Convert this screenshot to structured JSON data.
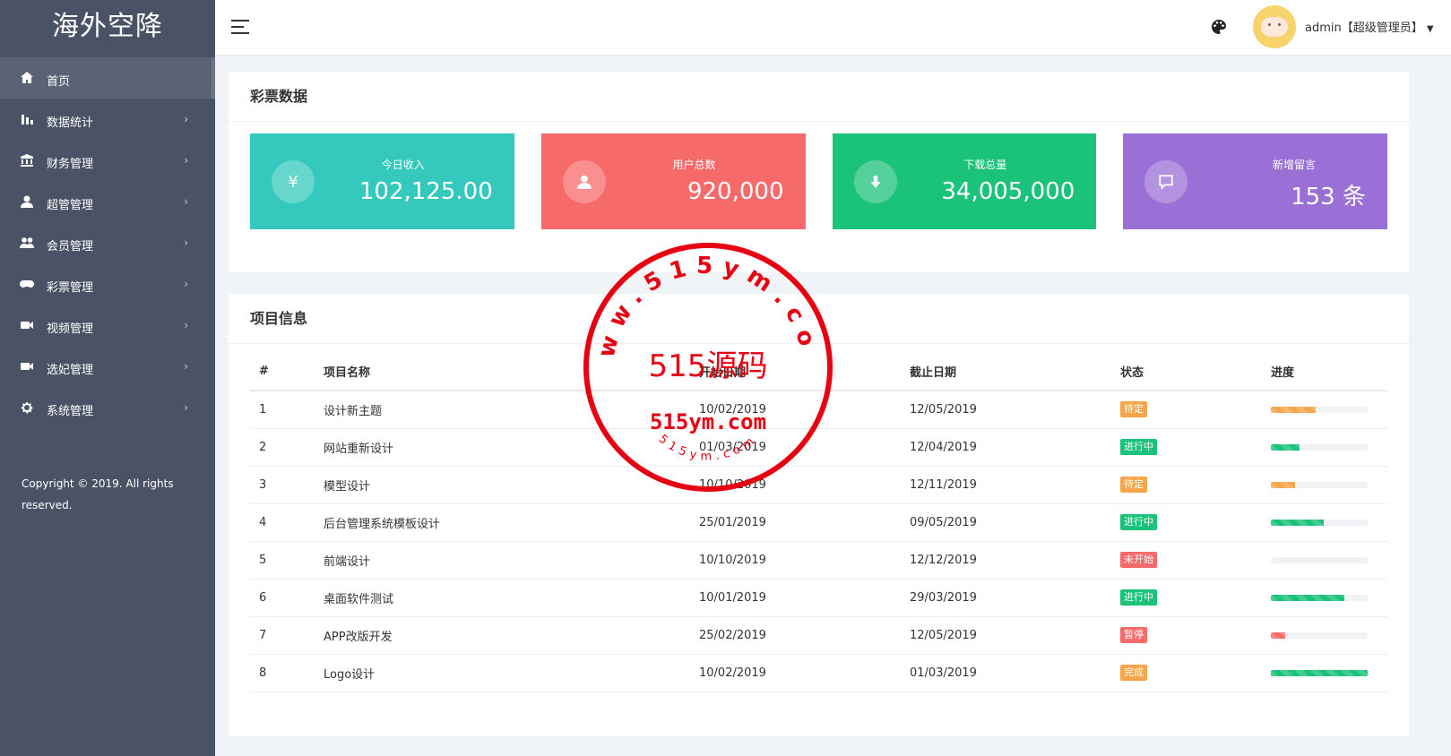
{
  "sidebar": {
    "brand": "海外空降",
    "items": [
      {
        "label": "首页",
        "icon": "home-icon"
      },
      {
        "label": "数据统计",
        "icon": "bar-chart-icon"
      },
      {
        "label": "财务管理",
        "icon": "bank-icon"
      },
      {
        "label": "超管管理",
        "icon": "user-icon"
      },
      {
        "label": "会员管理",
        "icon": "users-icon"
      },
      {
        "label": "彩票管理",
        "icon": "gamepad-icon"
      },
      {
        "label": "视频管理",
        "icon": "video-icon"
      },
      {
        "label": "选妃管理",
        "icon": "video-icon"
      },
      {
        "label": "系统管理",
        "icon": "gear-icon"
      }
    ],
    "copyright": "Copyright © 2019. All rights reserved."
  },
  "header": {
    "user": "admin【超级管理员】"
  },
  "lottery": {
    "title": "彩票数据",
    "cards": [
      {
        "label": "今日收入",
        "value": "102,125.00",
        "color": "#35c9bd",
        "icon": "yen-icon"
      },
      {
        "label": "用户总数",
        "value": "920,000",
        "color": "#f76a6a",
        "icon": "user-icon"
      },
      {
        "label": "下载总量",
        "value": "34,005,000",
        "color": "#1bc27a",
        "icon": "download-icon"
      },
      {
        "label": "新增留言",
        "value": "153 条",
        "color": "#9a6fd6",
        "icon": "comment-icon"
      }
    ]
  },
  "projects": {
    "title": "项目信息",
    "headers": [
      "#",
      "项目名称",
      "开始日期",
      "截止日期",
      "状态",
      "进度"
    ],
    "rows": [
      {
        "no": "1",
        "name": "设计新主题",
        "start": "10/02/2019",
        "end": "12/05/2019",
        "status": "待定",
        "status_color": "#f5a54a",
        "progress": 0.46,
        "bar_color": "#f5a54a"
      },
      {
        "no": "2",
        "name": "网站重新设计",
        "start": "01/03/2019",
        "end": "12/04/2019",
        "status": "进行中",
        "status_color": "#1bc27a",
        "progress": 0.3,
        "bar_color": "#1bc27a"
      },
      {
        "no": "3",
        "name": "模型设计",
        "start": "10/10/2019",
        "end": "12/11/2019",
        "status": "待定",
        "status_color": "#f5a54a",
        "progress": 0.25,
        "bar_color": "#f5a54a"
      },
      {
        "no": "4",
        "name": "后台管理系统模板设计",
        "start": "25/01/2019",
        "end": "09/05/2019",
        "status": "进行中",
        "status_color": "#1bc27a",
        "progress": 0.55,
        "bar_color": "#1bc27a"
      },
      {
        "no": "5",
        "name": "前端设计",
        "start": "10/10/2019",
        "end": "12/12/2019",
        "status": "未开始",
        "status_color": "#f76a6a",
        "progress": 0.0,
        "bar_color": "#f76a6a"
      },
      {
        "no": "6",
        "name": "桌面软件测试",
        "start": "10/01/2019",
        "end": "29/03/2019",
        "status": "进行中",
        "status_color": "#1bc27a",
        "progress": 0.76,
        "bar_color": "#1bc27a"
      },
      {
        "no": "7",
        "name": "APP改版开发",
        "start": "25/02/2019",
        "end": "12/05/2019",
        "status": "暂停",
        "status_color": "#f76a6a",
        "progress": 0.15,
        "bar_color": "#f76a6a"
      },
      {
        "no": "8",
        "name": "Logo设计",
        "start": "10/02/2019",
        "end": "01/03/2019",
        "status": "完成",
        "status_color": "#f5a54a",
        "progress": 1.0,
        "bar_color": "#1bc27a"
      }
    ]
  },
  "watermark": {
    "arc": "www.515ym.com",
    "center": "515源码",
    "domain": "515ym.com",
    "bottom": "515ym.com"
  }
}
